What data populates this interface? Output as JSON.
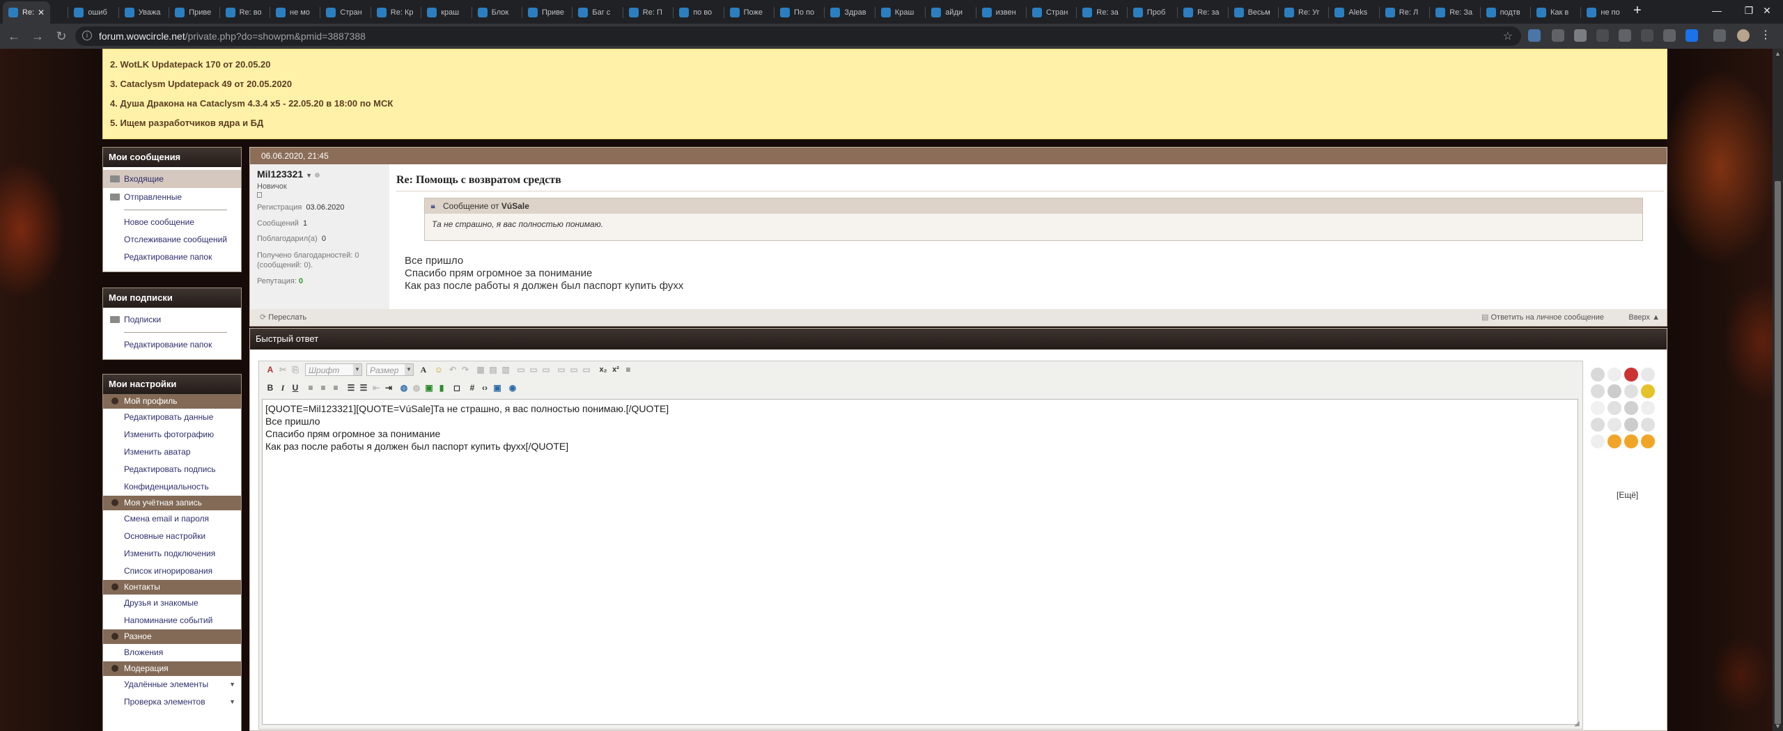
{
  "browser": {
    "tabs": [
      {
        "label": "Re:"
      },
      {
        "label": "ошиб"
      },
      {
        "label": "Уважа"
      },
      {
        "label": "Приве"
      },
      {
        "label": "Re: во"
      },
      {
        "label": "не мо"
      },
      {
        "label": "Стран"
      },
      {
        "label": "Re: Кр"
      },
      {
        "label": "краш"
      },
      {
        "label": "Блок"
      },
      {
        "label": "Приве"
      },
      {
        "label": "Баг с"
      },
      {
        "label": "Re: П"
      },
      {
        "label": "по во"
      },
      {
        "label": "Поже"
      },
      {
        "label": "По по"
      },
      {
        "label": "Здрав"
      },
      {
        "label": "Краш"
      },
      {
        "label": "айди"
      },
      {
        "label": "извен"
      },
      {
        "label": "Стран"
      },
      {
        "label": "Re: за"
      },
      {
        "label": "Проб"
      },
      {
        "label": "Re: за"
      },
      {
        "label": "Весьм"
      },
      {
        "label": "Re: Уг"
      },
      {
        "label": "Aleks"
      },
      {
        "label": "Re: Л"
      },
      {
        "label": "Re: За"
      },
      {
        "label": "подтв"
      },
      {
        "label": "Как в"
      },
      {
        "label": "не по"
      }
    ],
    "url_host": "forum.wowcircle.net",
    "url_path": "/private.php?do=showpm&pmid=3887388",
    "colors": {
      "tab_bg": "#202124",
      "toolbar_bg": "#35363a"
    }
  },
  "notice": {
    "lines": [
      "2. WotLK Updatepack 170 от 20.05.20",
      "3. Cataclysm Updatepack 49 от 20.05.2020",
      "4. Душа Дракона на Cataclysm 4.3.4 x5 - 22.05.20 в 18:00 по МСК",
      "5. Ищем разработчиков ядра и БД"
    ]
  },
  "sidebar": {
    "messages": {
      "title": "Мои сообщения",
      "folders": [
        "Входящие",
        "Отправленные"
      ],
      "links": [
        "Новое сообщение",
        "Отслеживание сообщений",
        "Редактирование папок"
      ]
    },
    "subscriptions": {
      "title": "Мои подписки",
      "folders": [
        "Подписки"
      ],
      "links": [
        "Редактирование папок"
      ]
    },
    "settings": {
      "title": "Мои настройки",
      "profile": {
        "title": "Мой профиль",
        "items": [
          "Редактировать данные",
          "Изменить фотографию",
          "Изменить аватар",
          "Редактировать подпись",
          "Конфиденциальность"
        ]
      },
      "account": {
        "title": "Моя учётная запись",
        "items": [
          "Смена email и пароля",
          "Основные настройки",
          "Изменить подключения",
          "Список игнорирования"
        ]
      },
      "contacts": {
        "title": "Контакты",
        "items": [
          "Друзья и знакомые",
          "Напоминание событий"
        ]
      },
      "misc": {
        "title": "Разное",
        "items": [
          "Вложения"
        ]
      },
      "moderation": {
        "title": "Модерация",
        "items": [
          "Удалённые элементы",
          "Проверка элементов"
        ]
      }
    }
  },
  "post": {
    "date": "06.06.2020, 21:45",
    "user": {
      "name": "Mil123321",
      "rank": "Новичок",
      "reg_label": "Регистрация",
      "reg_value": "03.06.2020",
      "posts_label": "Сообщений",
      "posts_value": "1",
      "thanked_label": "Поблагодарил(а)",
      "thanked_value": "0",
      "received": "Получено благодарностей: 0 (сообщений: 0).",
      "rep_label": "Репутация:",
      "rep_value": "0"
    },
    "title": "Re: Помощь с возвратом средств",
    "quote": {
      "header_prefix": "Сообщение от",
      "author": "VúSale",
      "text": "Та не страшно, я вас полностью понимаю."
    },
    "message": "Все пришло\nСпасибо прям огромное за понимание\nКак раз после работы я должен был паспорт купить фухх",
    "footer": {
      "forward": "Переслать",
      "reply": "Ответить на личное сообщение",
      "top": "Вверх ▲"
    }
  },
  "quick_reply": {
    "title": "Быстрый ответ",
    "font_placeholder": "Шрифт",
    "size_placeholder": "Размер",
    "text": "[QUOTE=Mil123321][QUOTE=VúSale]Та не страшно, я вас полностью понимаю.[/QUOTE]\nВсе пришло\nСпасибо прям огромное за понимание\nКак раз после работы я должен был паспорт купить фухх[/QUOTE]",
    "more_label": "[Ещё]"
  },
  "colors": {
    "notice_bg": "#fff2a8",
    "post_header": "#8b6d58",
    "category": "#836a56",
    "link": "#2e2f6d"
  }
}
